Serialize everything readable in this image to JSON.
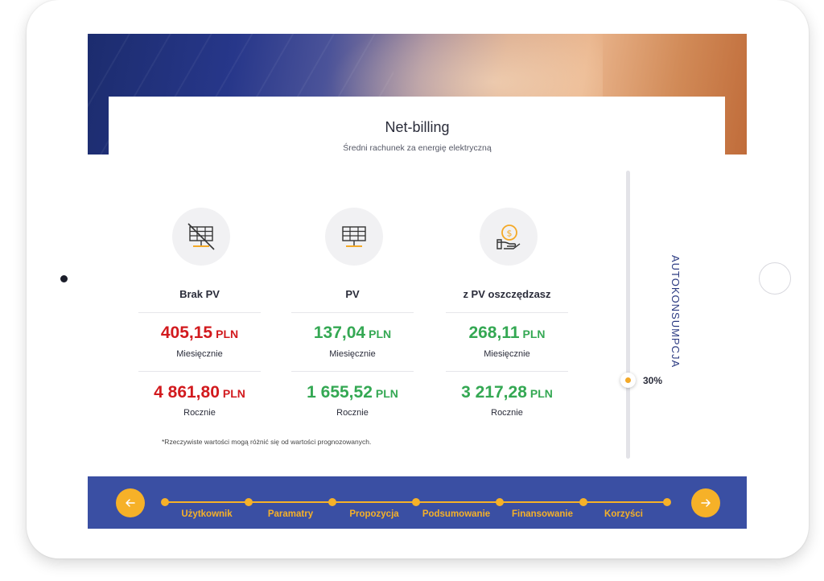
{
  "header": {
    "title": "Net-billing",
    "subtitle": "Średni rachunek za energię elektryczną"
  },
  "columns": [
    {
      "label": "Brak PV",
      "icon": "solar-panel-crossed-icon",
      "monthly_value": "405,15",
      "monthly_unit": "PLN",
      "monthly_label": "Miesięcznie",
      "yearly_value": "4 861,80",
      "yearly_unit": "PLN",
      "yearly_label": "Rocznie",
      "color": "#d21a1e"
    },
    {
      "label": "PV",
      "icon": "solar-panel-icon",
      "monthly_value": "137,04",
      "monthly_unit": "PLN",
      "monthly_label": "Miesięcznie",
      "yearly_value": "1 655,52",
      "yearly_unit": "PLN",
      "yearly_label": "Rocznie",
      "color": "#34a853"
    },
    {
      "label": "z PV oszczędzasz",
      "icon": "hand-coin-icon",
      "monthly_value": "268,11",
      "monthly_unit": "PLN",
      "monthly_label": "Miesięcznie",
      "yearly_value": "3 217,28",
      "yearly_unit": "PLN",
      "yearly_label": "Rocznie",
      "color": "#34a853"
    }
  ],
  "footnote": "*Rzeczywiste wartości mogą różnić się od wartości prognozowanych.",
  "slider": {
    "label": "AUTOKONSUMPCJA",
    "value_text": "30%",
    "value": 0.3
  },
  "nav": {
    "prev_icon": "arrow-left-icon",
    "next_icon": "arrow-right-icon",
    "steps": [
      "Użytkownik",
      "Paramatry",
      "Propozycja",
      "Podsumowanie",
      "Finansowanie",
      "Korzyści"
    ]
  },
  "colors": {
    "accent": "#f6b128",
    "nav_background": "#3a4fa3",
    "negative": "#d21a1e",
    "positive": "#34a853"
  }
}
